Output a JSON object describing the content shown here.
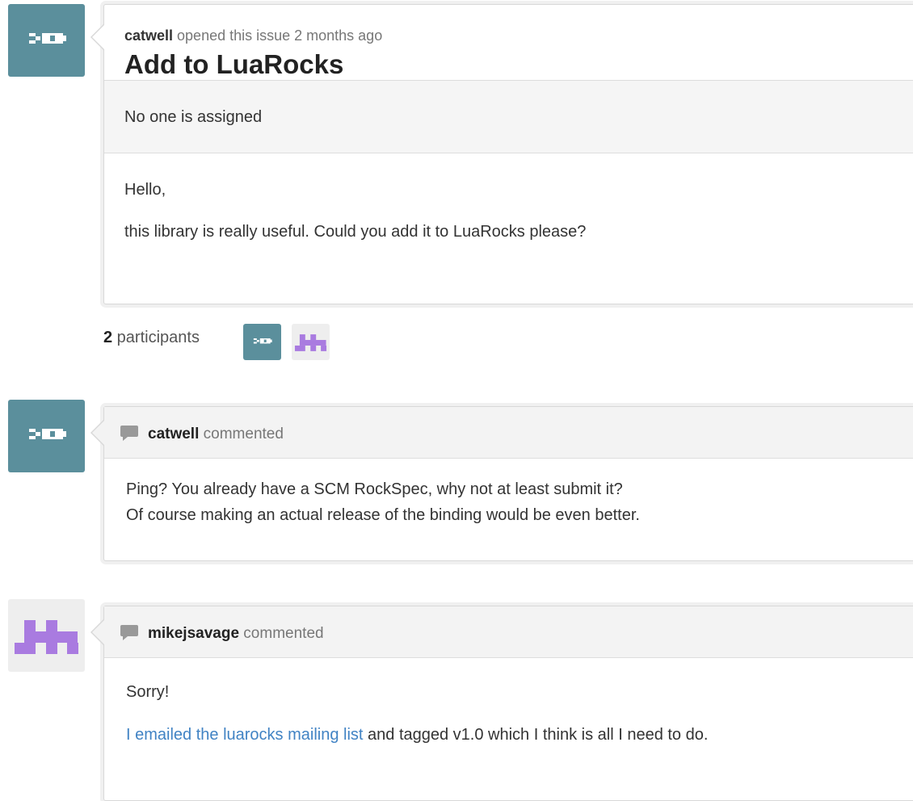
{
  "issue": {
    "author": "catwell",
    "meta_suffix": " opened this issue 2 months ago",
    "title": "Add to LuaRocks",
    "assignee_text": "No one is assigned",
    "body_line1": "Hello,",
    "body_line2": "this library is really useful. Could you add it to LuaRocks please?"
  },
  "participants": {
    "count": "2",
    "label": " participants"
  },
  "comments": [
    {
      "author": "catwell",
      "action": " commented",
      "line1": "Ping? You already have a SCM RockSpec, why not at least submit it?",
      "line2": "Of course making an actual release of the binding would be even better."
    },
    {
      "author": "mikejsavage",
      "action": " commented",
      "line1": "Sorry!",
      "link_text": "I emailed the luarocks mailing list",
      "line2_rest": " and tagged v1.0 which I think is all I need to do."
    }
  ],
  "colors": {
    "catwell_avatar_bg": "#5b8f9c",
    "mikejsavage_avatar_bg": "#eeeeee",
    "mikejsavage_avatar_fg": "#a97be0",
    "link": "#4183c4"
  },
  "icons": [
    "catwell-avatar-icon",
    "mikejsavage-avatar-icon",
    "comment-bubble-icon"
  ]
}
